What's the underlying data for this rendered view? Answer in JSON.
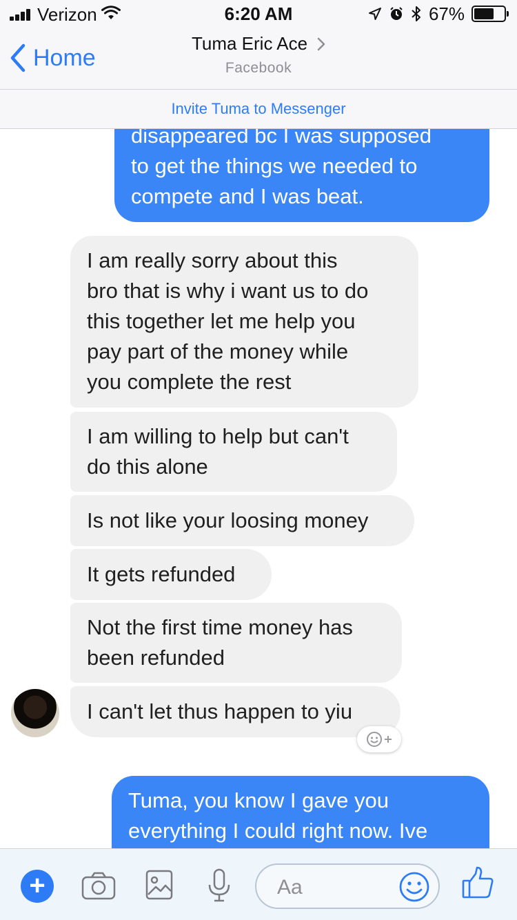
{
  "status_bar": {
    "carrier": "Verizon",
    "time": "6:20 AM",
    "battery": "67%",
    "battery_level": 0.67
  },
  "nav": {
    "back_label": "Home",
    "contact_name": "Tuma Eric Ace",
    "contact_source": "Facebook",
    "invite_label": "Invite Tuma to Messenger"
  },
  "messages": [
    {
      "direction": "outgoing",
      "lines": [
        "disappeared bc I was supposed",
        "to get the things we needed to",
        "compete and I was beat."
      ]
    },
    {
      "direction": "incoming",
      "lines": [
        "I am really sorry about this",
        "bro that is why i want us to do",
        "this together let me help you",
        "pay part of the money while",
        "you complete the rest"
      ]
    },
    {
      "direction": "incoming",
      "lines": [
        "I am willing to help but can't",
        "do this alone"
      ]
    },
    {
      "direction": "incoming",
      "lines": [
        "Is not like your loosing money"
      ]
    },
    {
      "direction": "incoming",
      "lines": [
        "It gets refunded"
      ]
    },
    {
      "direction": "incoming",
      "lines": [
        "Not the first time money has",
        "been refunded"
      ]
    },
    {
      "direction": "incoming",
      "lines": [
        "I can't let thus happen to yiu"
      ]
    },
    {
      "direction": "outgoing",
      "lines": [
        "Tuma, you know I gave you",
        "everything I could right now. Ive"
      ]
    }
  ],
  "composer": {
    "placeholder": "Aa",
    "icons": [
      "plus-icon",
      "camera-icon",
      "photo-icon",
      "microphone-icon",
      "emoji-icon",
      "thumbs-up-icon"
    ]
  },
  "colors": {
    "accent": "#2d7cf6",
    "outgoing_bubble": "#3b86f7",
    "incoming_bubble": "#f0f0f0",
    "header_bg": "#f7f7f9",
    "composer_bg": "#eef5fb"
  }
}
